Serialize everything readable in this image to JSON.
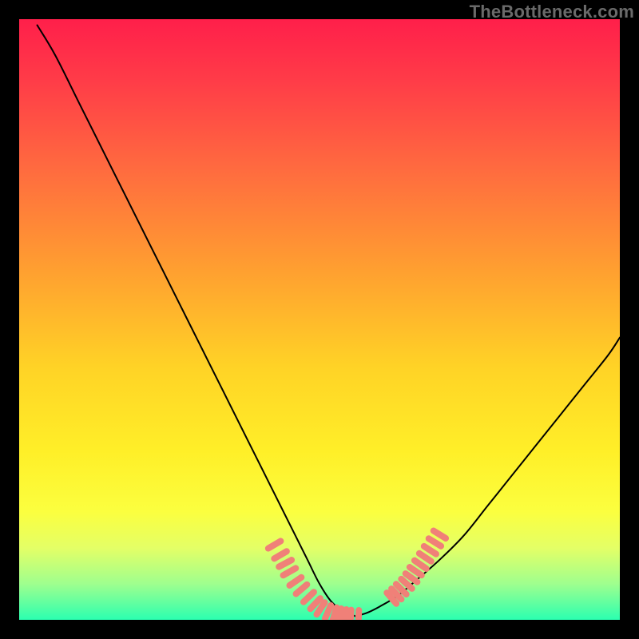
{
  "watermark": "TheBottleneck.com",
  "chart_data": {
    "type": "line",
    "title": "",
    "xlabel": "",
    "ylabel": "",
    "xlim": [
      0,
      100
    ],
    "ylim": [
      0,
      100
    ],
    "grid": false,
    "legend": false,
    "series": [
      {
        "name": "curve-left",
        "color": "#000000",
        "x": [
          3,
          6,
          10,
          14,
          18,
          22,
          26,
          30,
          34,
          38,
          42,
          46,
          48,
          50,
          52,
          54,
          56
        ],
        "values": [
          99,
          94,
          86,
          78,
          70,
          62,
          54,
          46,
          38,
          30,
          22,
          14,
          10,
          6,
          3,
          1.5,
          0.6
        ]
      },
      {
        "name": "curve-right",
        "color": "#000000",
        "x": [
          56,
          58,
          60,
          63,
          66,
          70,
          74,
          78,
          82,
          86,
          90,
          94,
          98,
          100
        ],
        "values": [
          0.6,
          1.2,
          2.2,
          4,
          6.5,
          10,
          14,
          19,
          24,
          29,
          34,
          39,
          44,
          47
        ]
      },
      {
        "name": "markers-left",
        "color": "#f08078",
        "marker": "tick",
        "x": [
          42.5,
          43.5,
          44.3,
          45.0,
          46.0,
          47.0,
          48.2,
          49.3,
          50.2,
          51.4,
          52.5,
          53.4,
          54.3,
          55.2,
          56.5
        ],
        "values": [
          12.5,
          10.8,
          9.4,
          8.0,
          6.4,
          5.1,
          3.8,
          2.7,
          1.9,
          1.3,
          0.9,
          0.7,
          0.55,
          0.45,
          0.4
        ]
      },
      {
        "name": "markers-right",
        "color": "#f08078",
        "marker": "tick",
        "x": [
          62.0,
          62.8,
          63.6,
          64.5,
          65.3,
          66.0,
          66.8,
          67.6,
          68.4,
          69.2,
          70.0
        ],
        "values": [
          3.6,
          4.3,
          5.1,
          6.0,
          7.0,
          8.1,
          9.2,
          10.4,
          11.6,
          12.9,
          14.2
        ]
      }
    ]
  }
}
